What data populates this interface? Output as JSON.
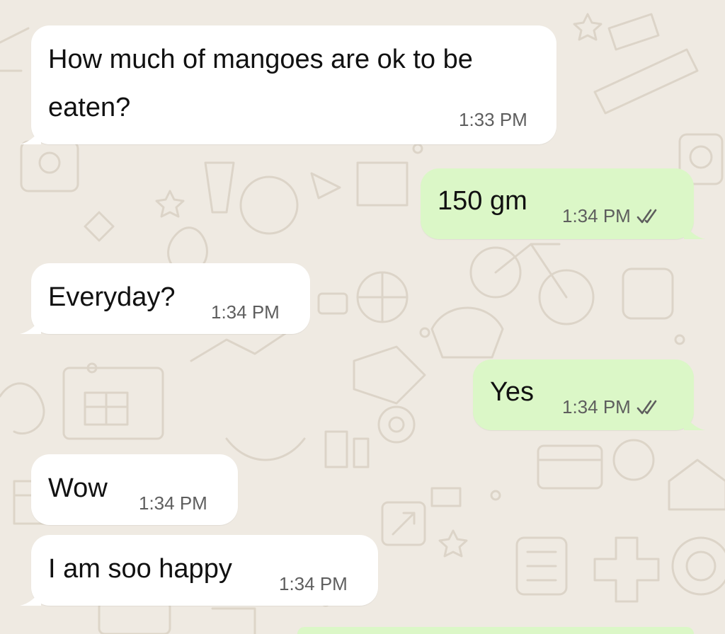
{
  "chat": {
    "messages": [
      {
        "direction": "incoming",
        "text": "How much of mangoes are ok to be eaten?",
        "time": "1:33 PM"
      },
      {
        "direction": "outgoing",
        "text": "150 gm",
        "time": "1:34 PM",
        "status": "read-double-check"
      },
      {
        "direction": "incoming",
        "text": "Everyday?",
        "time": "1:34 PM"
      },
      {
        "direction": "outgoing",
        "text": "Yes",
        "time": "1:34 PM",
        "status": "read-double-check"
      },
      {
        "direction": "incoming",
        "text": "Wow",
        "time": "1:34 PM"
      },
      {
        "direction": "incoming",
        "text": "I am soo happy",
        "time": "1:34 PM"
      }
    ]
  },
  "colors": {
    "background": "#EFEAE2",
    "incoming_bubble": "#FFFFFF",
    "outgoing_bubble": "#DBF7C7",
    "text": "#111111",
    "timestamp": "#5E5E5E",
    "tick": "#5E5E5E"
  }
}
